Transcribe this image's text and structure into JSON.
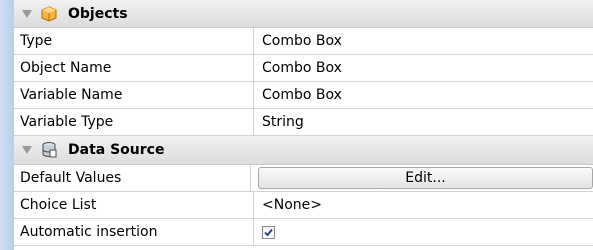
{
  "sections": [
    {
      "title": "Objects",
      "icon": "objects-box-icon",
      "rows": [
        {
          "name": "Type",
          "value": "Combo Box"
        },
        {
          "name": "Object Name",
          "value": "Combo Box"
        },
        {
          "name": "Variable Name",
          "value": "Combo Box"
        },
        {
          "name": "Variable Type",
          "value": "String"
        }
      ]
    },
    {
      "title": "Data Source",
      "icon": "data-source-icon",
      "rows": [
        {
          "name": "Default Values",
          "button_label": "Edit..."
        },
        {
          "name": "Choice List",
          "value": "<None>"
        },
        {
          "name": "Automatic insertion",
          "checked": true
        }
      ]
    }
  ]
}
